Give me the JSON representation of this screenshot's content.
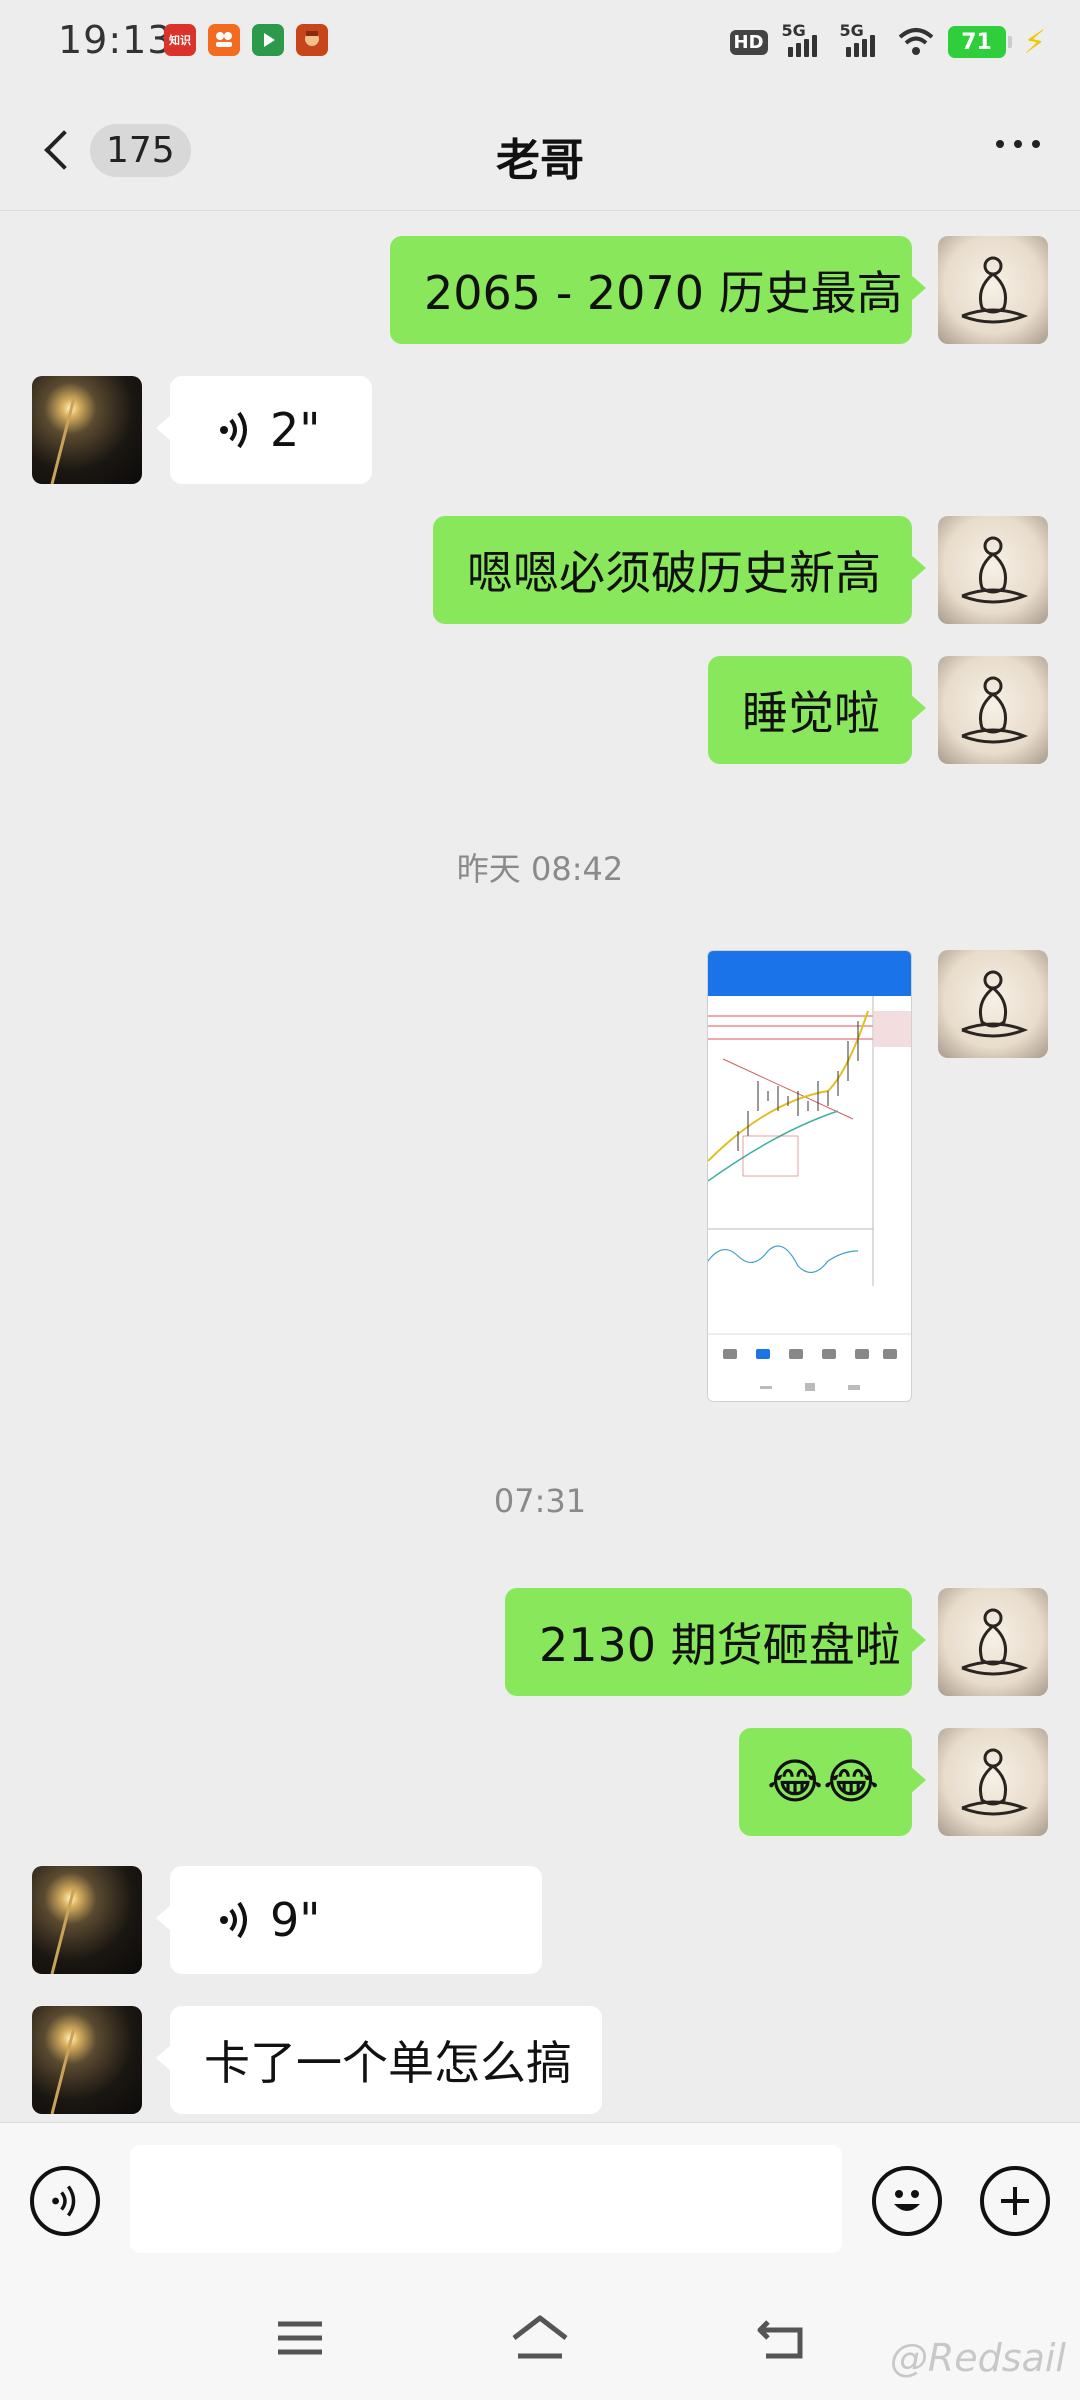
{
  "status_bar": {
    "time": "19:13",
    "app_icons": [
      {
        "name": "zhishi-app-icon",
        "text": "知识",
        "color": "#d9332b"
      },
      {
        "name": "orange-app-icon",
        "text": "",
        "color": "#f36b21"
      },
      {
        "name": "video-app-icon",
        "text": "",
        "color": "#2c9a4a"
      },
      {
        "name": "game-app-icon",
        "text": "",
        "color": "#c7451d"
      }
    ],
    "hd_label": "HD",
    "network_1": "5G",
    "network_2": "5G",
    "battery": "71"
  },
  "nav": {
    "unread_count": "175",
    "title": "老哥"
  },
  "messages": [
    {
      "sender": "self",
      "type": "text",
      "text": "2065 - 2070 历史最高"
    },
    {
      "sender": "other",
      "type": "voice",
      "duration": "2\""
    },
    {
      "sender": "self",
      "type": "text",
      "text": "嗯嗯必须破历史新高"
    },
    {
      "sender": "self",
      "type": "text",
      "text": "睡觉啦"
    },
    {
      "type": "timestamp",
      "text": "昨天 08:42"
    },
    {
      "sender": "self",
      "type": "image"
    },
    {
      "type": "timestamp",
      "text": "07:31"
    },
    {
      "sender": "self",
      "type": "text",
      "text": "2130 期货砸盘啦"
    },
    {
      "sender": "self",
      "type": "text",
      "text": "😂😂"
    },
    {
      "sender": "other",
      "type": "voice",
      "duration": "9\""
    },
    {
      "sender": "other",
      "type": "text",
      "text": "卡了一个单怎么搞"
    }
  ],
  "input_bar": {
    "placeholder": ""
  },
  "watermark": "@Redsail",
  "colors": {
    "self_bubble": "#89e75c",
    "other_bubble": "#ffffff",
    "background": "#ededed"
  }
}
